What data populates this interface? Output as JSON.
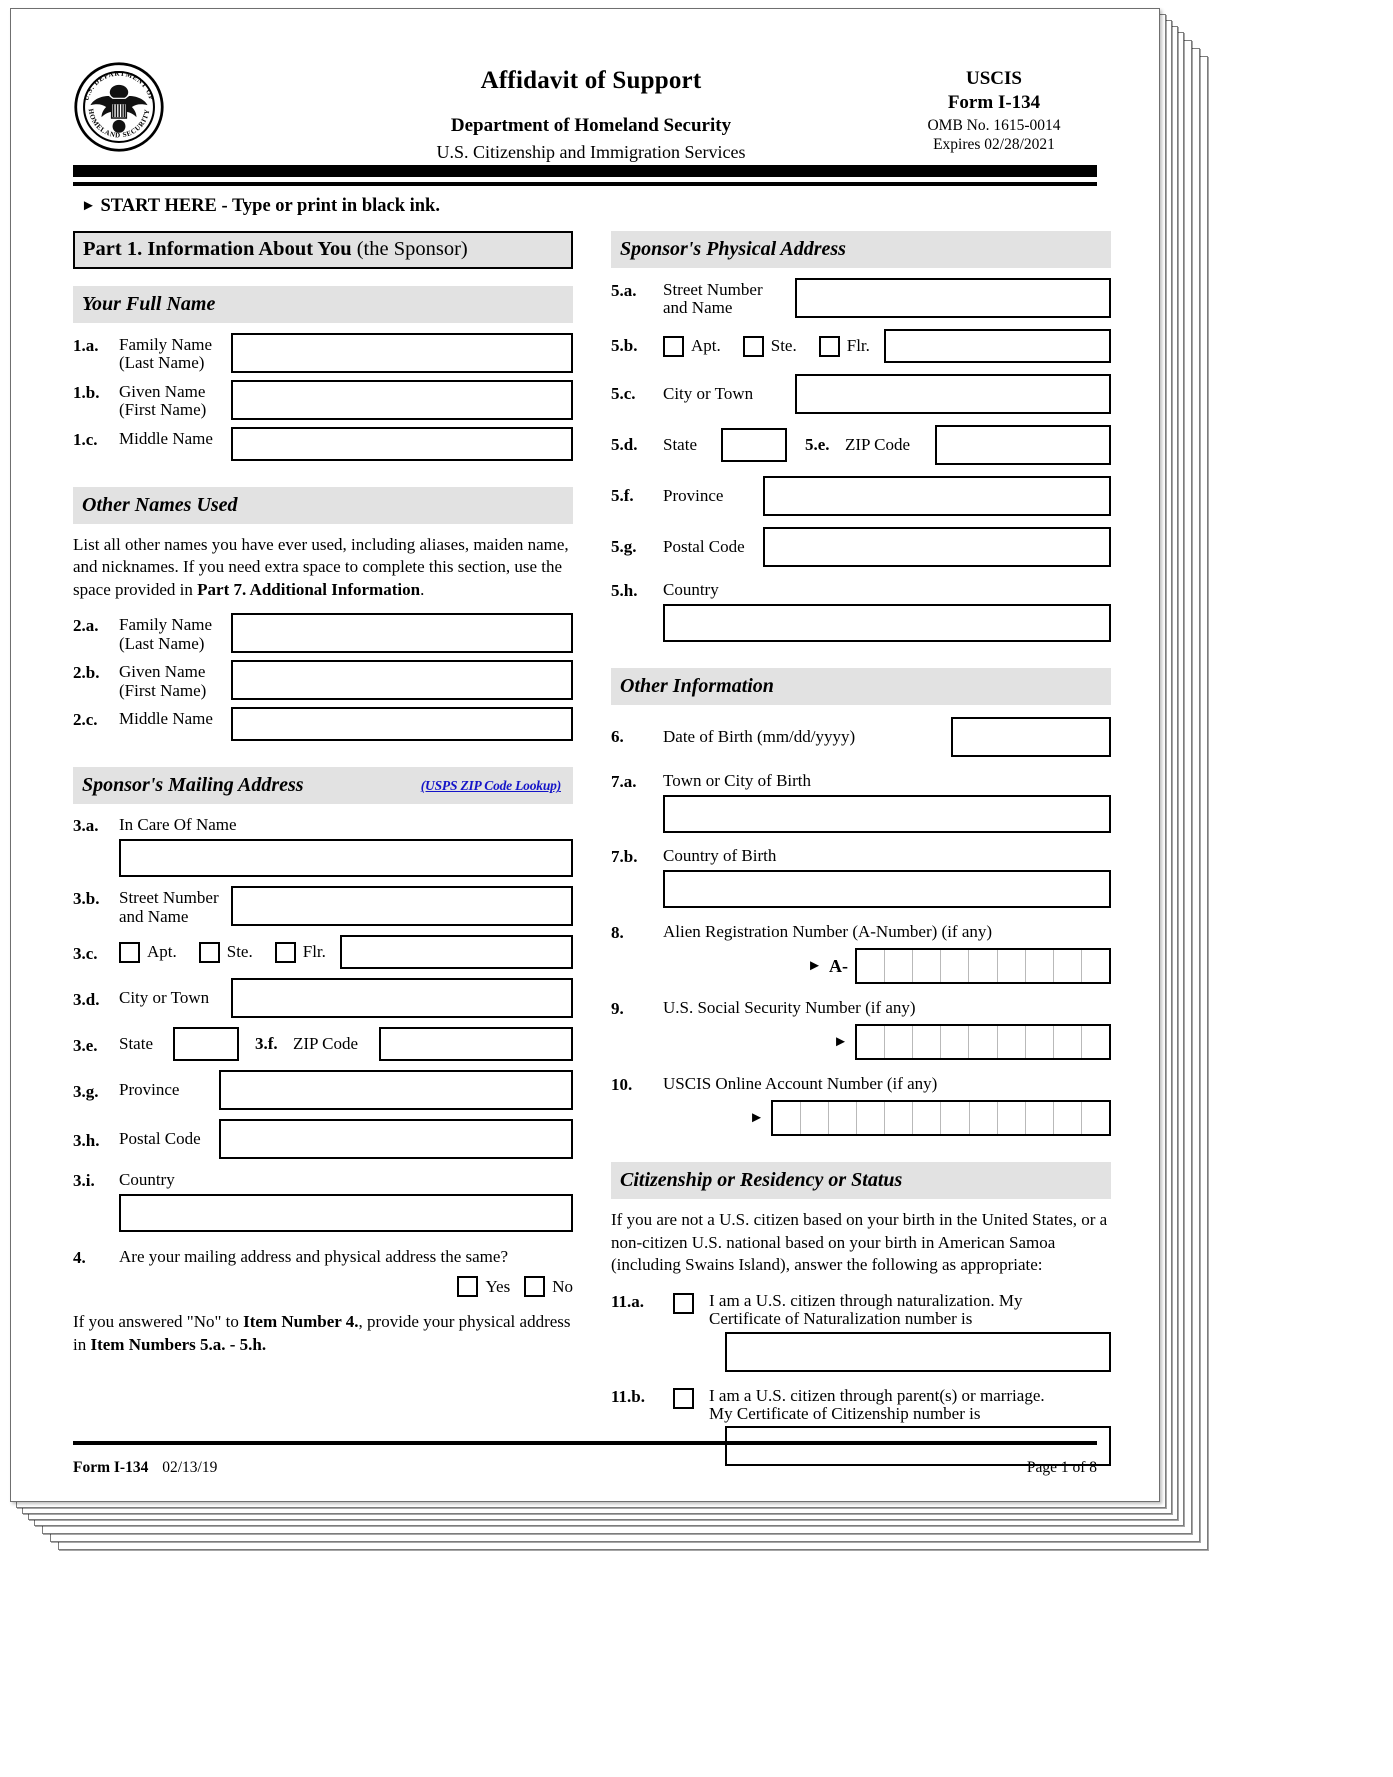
{
  "header": {
    "title": "Affidavit of Support",
    "agency": "Department of Homeland Security",
    "bureau": "U.S. Citizenship and Immigration Services",
    "uscis": "USCIS",
    "form_number": "Form I-134",
    "omb": "OMB No. 1615-0014",
    "expires": "Expires 02/28/2021",
    "seal_outer_top": "U.S. DEPARTMENT OF",
    "seal_outer_bottom": "HOMELAND SECURITY"
  },
  "start_here": {
    "arrow": "►",
    "bold": "START HERE",
    "rest": "- Type or print in black ink."
  },
  "left": {
    "part_banner": {
      "bold": "Part 1.  Information About You",
      "light": "(the Sponsor)"
    },
    "full_name": {
      "heading": "Your Full Name",
      "rows": [
        {
          "num": "1.a.",
          "label_line1": "Family Name",
          "label_line2": "(Last Name)"
        },
        {
          "num": "1.b.",
          "label_line1": "Given Name",
          "label_line2": "(First Name)"
        },
        {
          "num": "1.c.",
          "label_line1": "Middle Name",
          "label_line2": ""
        }
      ]
    },
    "other_names": {
      "heading": "Other Names Used",
      "instruction_1": "List all other names you have ever used, including aliases, maiden name, and nicknames.  If you need extra space to complete this section, use the space provided in ",
      "instruction_bold": "Part 7. Additional Information",
      "instruction_2": ".",
      "rows": [
        {
          "num": "2.a.",
          "label_line1": "Family Name",
          "label_line2": "(Last Name)"
        },
        {
          "num": "2.b.",
          "label_line1": "Given Name",
          "label_line2": "(First Name)"
        },
        {
          "num": "2.c.",
          "label_line1": "Middle Name",
          "label_line2": ""
        }
      ]
    },
    "mailing_address": {
      "heading": "Sponsor's Mailing Address",
      "usps_link": "(USPS ZIP Code Lookup)",
      "in_care_of": {
        "num": "3.a.",
        "label": "In Care Of Name"
      },
      "street": {
        "num": "3.b.",
        "label_line1": "Street Number",
        "label_line2": "and Name"
      },
      "unit": {
        "num": "3.c.",
        "options": [
          "Apt.",
          "Ste.",
          "Flr."
        ]
      },
      "city": {
        "num": "3.d.",
        "label": "City or Town"
      },
      "state": {
        "num": "3.e.",
        "label": "State"
      },
      "zip": {
        "num": "3.f.",
        "label": "ZIP Code"
      },
      "province": {
        "num": "3.g.",
        "label": "Province"
      },
      "postal": {
        "num": "3.h.",
        "label": "Postal Code"
      },
      "country": {
        "num": "3.i.",
        "label": "Country"
      }
    },
    "item4": {
      "num": "4.",
      "question": "Are your mailing address and physical address the same?",
      "yes": "Yes",
      "no": "No",
      "note_1": "If you answered \"No\" to ",
      "note_bold_1": "Item Number 4.",
      "note_2": ", provide your physical address in ",
      "note_bold_2": "Item Numbers 5.a. - 5.h.",
      "note_3": ""
    }
  },
  "right": {
    "physical_address": {
      "heading": "Sponsor's Physical Address",
      "street": {
        "num": "5.a.",
        "label_line1": "Street Number",
        "label_line2": "and Name"
      },
      "unit": {
        "num": "5.b.",
        "options": [
          "Apt.",
          "Ste.",
          "Flr."
        ]
      },
      "city": {
        "num": "5.c.",
        "label": "City or Town"
      },
      "state": {
        "num": "5.d.",
        "label": "State"
      },
      "zip": {
        "num": "5.e.",
        "label": "ZIP Code"
      },
      "province": {
        "num": "5.f.",
        "label": "Province"
      },
      "postal": {
        "num": "5.g.",
        "label": "Postal Code"
      },
      "country": {
        "num": "5.h.",
        "label": "Country"
      }
    },
    "other_information": {
      "heading": "Other Information",
      "dob": {
        "num": "6.",
        "label": "Date of Birth (mm/dd/yyyy)"
      },
      "town_of_birth": {
        "num": "7.a.",
        "label": "Town or City of Birth"
      },
      "country_of_birth": {
        "num": "7.b.",
        "label": "Country of Birth"
      },
      "a_number": {
        "num": "8.",
        "label": "Alien Registration Number (A-Number) (if any)",
        "arrow": "►",
        "prefix": "A-",
        "cells": 9
      },
      "ssn": {
        "num": "9.",
        "label": "U.S. Social Security Number (if any)",
        "arrow": "►",
        "cells": 9
      },
      "online_account": {
        "num": "10.",
        "label": "USCIS Online Account Number (if any)",
        "arrow": "►",
        "cells": 12
      }
    },
    "citizenship": {
      "heading": "Citizenship or Residency or Status",
      "intro": "If you are not a U.S. citizen based on your birth in the United States, or a non-citizen U.S. national based on your birth in American Samoa (including Swains Island), answer the following as appropriate:",
      "item_11a": {
        "num": "11.a.",
        "line1": "I am a U.S. citizen through naturalization.  My",
        "line2": "Certificate of Naturalization number is"
      },
      "item_11b": {
        "num": "11.b.",
        "line1": "I am a U.S. citizen through parent(s) or marriage.",
        "line2": "My Certificate of Citizenship number is"
      }
    }
  },
  "footer": {
    "form_bold": "Form I-134",
    "form_date": "02/13/19",
    "page": "Page 1 of 8"
  },
  "colors": {
    "banner_gray": "#e2e2e2",
    "link_blue": "#1414c8",
    "rule_black": "#000000"
  }
}
